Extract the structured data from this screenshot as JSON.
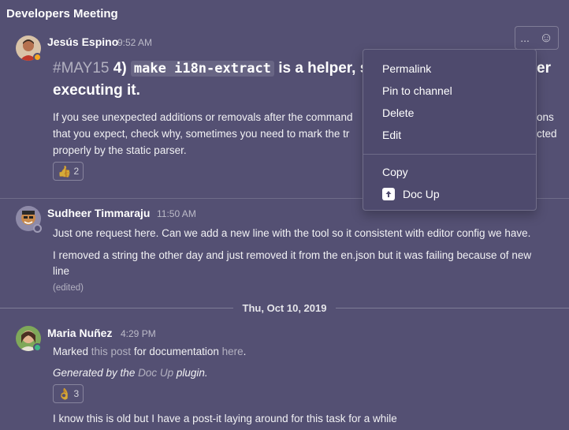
{
  "channel": {
    "title": "Developers Meeting"
  },
  "post1": {
    "author": "Jesús Espino",
    "time": "9:52 AM",
    "hashtag": "#MAY15",
    "heading_prefix": " 4) ",
    "code": "make i18n-extract",
    "heading_mid": " is a helper, s",
    "heading_tail": "er",
    "heading_line2": "executing it.",
    "body_line1": "If you see unexpected additions or removals after the command",
    "body_line1_tail": "ons",
    "body_line2": "that you expect, check why, sometimes you need to mark the tr",
    "body_line2_tail": "cted",
    "body_line3": "properly by the static parser.",
    "reaction": {
      "emoji": "👍",
      "count": "2"
    },
    "status_color": "#f5a623"
  },
  "post_actions": {
    "more": "...",
    "emoji": "☺"
  },
  "menu": {
    "items": [
      "Permalink",
      "Pin to channel",
      "Delete",
      "Edit"
    ],
    "copy": "Copy",
    "plugin": "Doc Up"
  },
  "post2": {
    "author": "Sudheer Timmaraju",
    "time": "11:50 AM",
    "line1": "Just one request here. Can we add a new line with the tool so it consistent with editor config we have.",
    "line2": "I removed a string the other day and just removed it from the en.json but it was failing because of new",
    "line3": "line",
    "edited": "(edited)"
  },
  "date_separator": "Thu, Oct 10, 2019",
  "post3": {
    "author": "Maria Nuñez",
    "time": "4:29 PM",
    "marked_prefix": "Marked ",
    "this_post": "this post",
    "marked_mid": " for documentation ",
    "here": "here",
    "marked_end": ".",
    "generated_prefix": "Generated by the ",
    "doc_up": "Doc Up",
    "generated_suffix": " plugin.",
    "reaction": {
      "emoji": "👌",
      "count": "3"
    },
    "status_color": "#3db887",
    "line_last": "I know this is old but I have a post-it laying around for this task for a while"
  }
}
